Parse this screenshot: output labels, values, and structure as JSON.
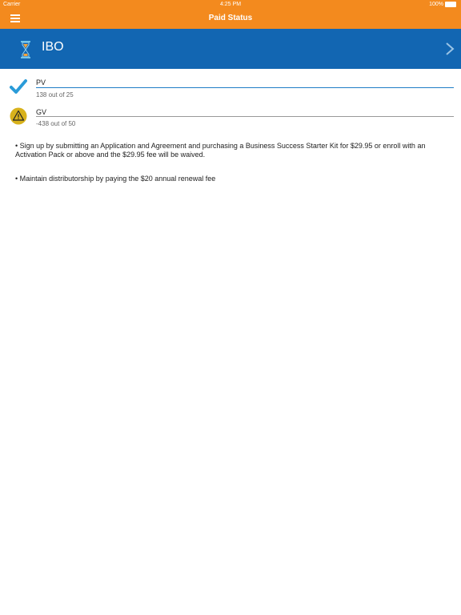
{
  "status_bar": {
    "carrier": "Carrier",
    "time": "4:25 PM",
    "battery": "100%"
  },
  "nav": {
    "title": "Paid Status",
    "menu_icon": "hamburger-menu-icon"
  },
  "banner": {
    "title": "IBO",
    "icon": "hourglass-icon",
    "next_icon": "chevron-right-icon"
  },
  "requirements": [
    {
      "label": "PV",
      "detail": "138 out of 25",
      "status": "met",
      "icon": "checkmark-icon"
    },
    {
      "label": "GV",
      "detail": "-438 out of 50",
      "status": "warning",
      "icon": "warning-icon"
    }
  ],
  "notes": [
    "• Sign up by submitting an Application and Agreement and purchasing a Business Success Starter Kit for $29.95 or enroll with an Activation Pack or above and the $29.95 fee will be waived.",
    "• Maintain distributorship by paying the $20 annual renewal fee"
  ],
  "colors": {
    "nav": "#f38a1e",
    "banner": "#1266b2",
    "check": "#2a9bd8",
    "warning": "#d8b21c"
  }
}
